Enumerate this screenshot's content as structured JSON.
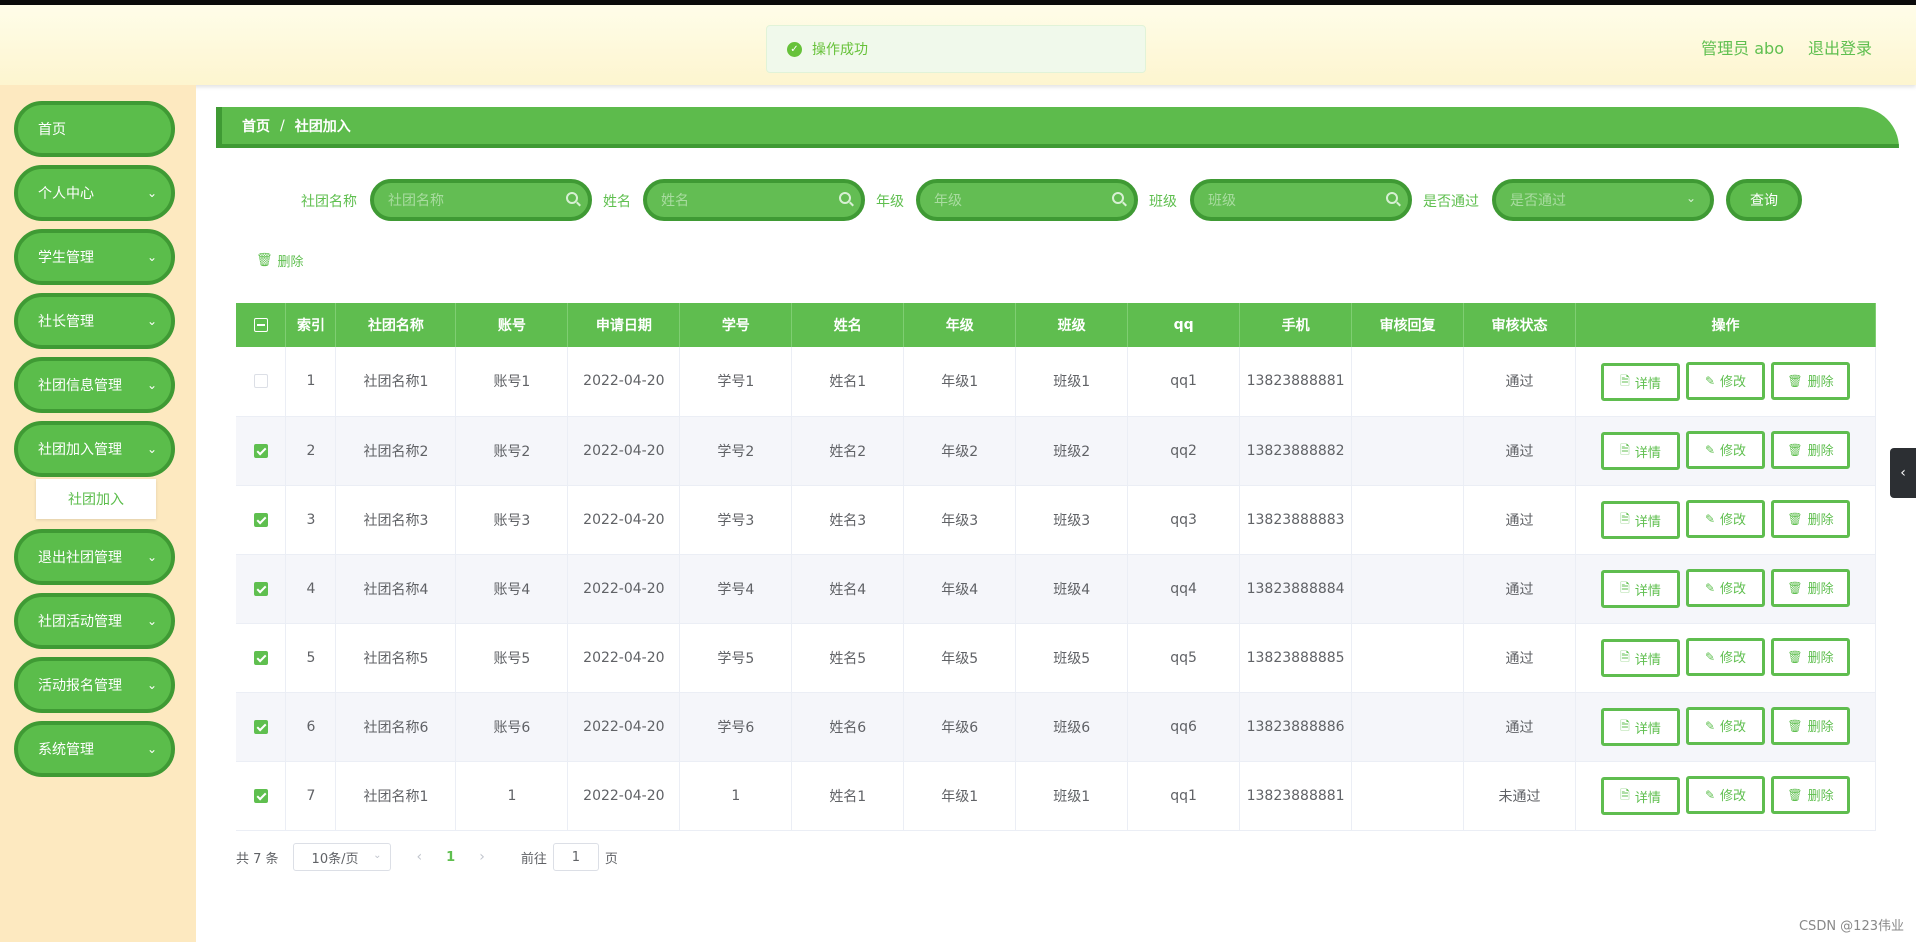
{
  "header": {
    "user_label": "管理员 abo",
    "logout_label": "退出登录"
  },
  "toast": {
    "message": "操作成功"
  },
  "sidebar": {
    "items": [
      {
        "label": "首页"
      },
      {
        "label": "个人中心"
      },
      {
        "label": "学生管理"
      },
      {
        "label": "社长管理"
      },
      {
        "label": "社团信息管理"
      },
      {
        "label": "社团加入管理"
      },
      {
        "label": "退出社团管理"
      },
      {
        "label": "社团活动管理"
      },
      {
        "label": "活动报名管理"
      },
      {
        "label": "系统管理"
      }
    ],
    "submenu": {
      "label": "社团加入"
    }
  },
  "breadcrumb": {
    "home": "首页",
    "separator": "/",
    "current": "社团加入"
  },
  "search": {
    "fields": [
      {
        "label": "社团名称",
        "placeholder": "社团名称"
      },
      {
        "label": "姓名",
        "placeholder": "姓名"
      },
      {
        "label": "年级",
        "placeholder": "年级"
      },
      {
        "label": "班级",
        "placeholder": "班级"
      },
      {
        "label": "是否通过",
        "placeholder": "是否通过"
      }
    ],
    "query_label": "查询"
  },
  "toolbar": {
    "delete_label": "删除"
  },
  "table": {
    "columns": [
      "索引",
      "社团名称",
      "账号",
      "申请日期",
      "学号",
      "姓名",
      "年级",
      "班级",
      "qq",
      "手机",
      "审核回复",
      "审核状态",
      "操作"
    ],
    "rows": [
      {
        "checked": false,
        "cells": [
          "1",
          "社团名称1",
          "账号1",
          "2022-04-20",
          "学号1",
          "姓名1",
          "年级1",
          "班级1",
          "qq1",
          "13823888881",
          "",
          "通过"
        ]
      },
      {
        "checked": true,
        "cells": [
          "2",
          "社团名称2",
          "账号2",
          "2022-04-20",
          "学号2",
          "姓名2",
          "年级2",
          "班级2",
          "qq2",
          "13823888882",
          "",
          "通过"
        ]
      },
      {
        "checked": true,
        "cells": [
          "3",
          "社团名称3",
          "账号3",
          "2022-04-20",
          "学号3",
          "姓名3",
          "年级3",
          "班级3",
          "qq3",
          "13823888883",
          "",
          "通过"
        ]
      },
      {
        "checked": true,
        "cells": [
          "4",
          "社团名称4",
          "账号4",
          "2022-04-20",
          "学号4",
          "姓名4",
          "年级4",
          "班级4",
          "qq4",
          "13823888884",
          "",
          "通过"
        ]
      },
      {
        "checked": true,
        "cells": [
          "5",
          "社团名称5",
          "账号5",
          "2022-04-20",
          "学号5",
          "姓名5",
          "年级5",
          "班级5",
          "qq5",
          "13823888885",
          "",
          "通过"
        ]
      },
      {
        "checked": true,
        "cells": [
          "6",
          "社团名称6",
          "账号6",
          "2022-04-20",
          "学号6",
          "姓名6",
          "年级6",
          "班级6",
          "qq6",
          "13823888886",
          "",
          "通过"
        ]
      },
      {
        "checked": true,
        "cells": [
          "7",
          "社团名称1",
          "1",
          "2022-04-20",
          "1",
          "姓名1",
          "年级1",
          "班级1",
          "qq1",
          "13823888881",
          "",
          "未通过"
        ]
      }
    ],
    "actions": {
      "detail_label": "详情",
      "edit_label": "修改",
      "delete_label": "删除"
    }
  },
  "pagination": {
    "total_label": "共 7 条",
    "page_size": "10条/页",
    "current_page": "1",
    "goto_prefix": "前往",
    "goto_value": "1",
    "goto_suffix": "页"
  },
  "watermark": "CSDN @123伟业",
  "colors": {
    "accent": "#5dbb4c",
    "accent_dark": "#3f9a34",
    "sidebar_bg": "#fde9c0",
    "header_bg": "#fdf5cf"
  }
}
